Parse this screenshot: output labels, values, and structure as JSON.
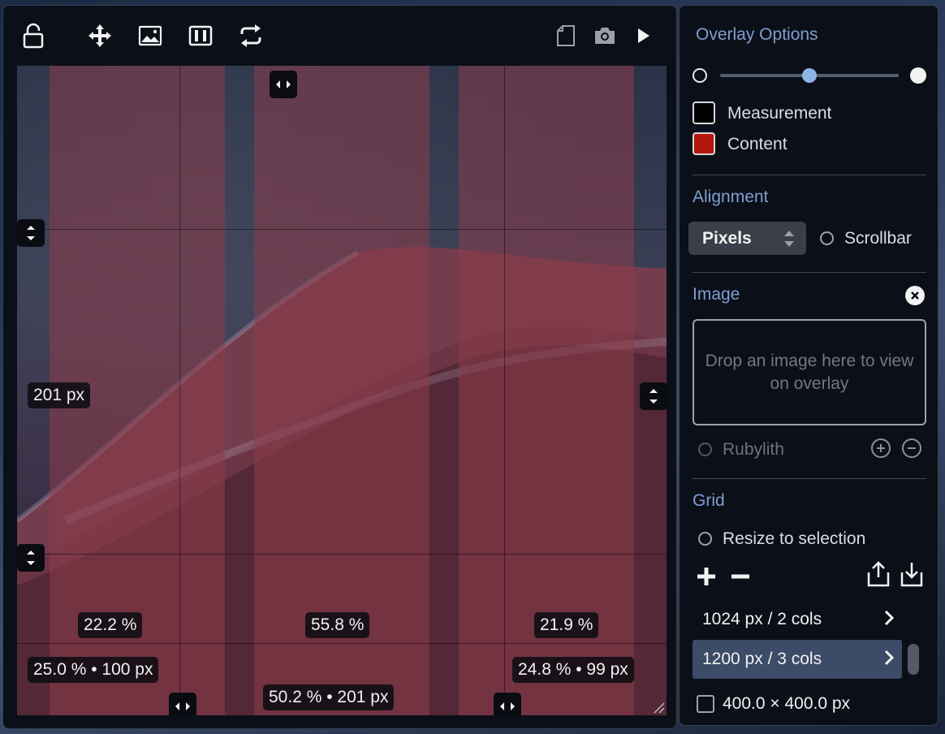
{
  "toolbar": {
    "icons": [
      "lock-icon",
      "move-icon",
      "image-icon",
      "columns-icon",
      "swap-icon",
      "document-icon",
      "camera-icon",
      "play-icon"
    ]
  },
  "overlay": {
    "labels": {
      "row_height": "201 px",
      "col1_pct": "22.2 %",
      "col2_pct": "55.8 %",
      "col3_pct": "21.9 %",
      "left_margin": "25.0 % • 100 px",
      "gutter_center": "50.2 % • 201 px",
      "right_margin": "24.8 % • 99 px"
    }
  },
  "panel": {
    "title": "Overlay Options",
    "opacity_level": 0.5,
    "colors": [
      {
        "label": "Measurement",
        "color": "#000000"
      },
      {
        "label": "Content",
        "color": "#b3170e"
      }
    ],
    "alignment": {
      "title": "Alignment",
      "mode": "Pixels",
      "scrollbar_label": "Scrollbar"
    },
    "image": {
      "title": "Image",
      "drop_text": "Drop an image here to view on overlay",
      "rubylith_label": "Rubylith"
    },
    "grid": {
      "title": "Grid",
      "resize_label": "Resize to selection",
      "items": [
        {
          "label": "1024 px / 2 cols",
          "selected": false
        },
        {
          "label": "1200 px / 3 cols",
          "selected": true
        }
      ],
      "size_label": "400.0 × 400.0 px"
    }
  },
  "theme": {
    "accent": "#7f9ed0",
    "content_color": "#b3170e",
    "panel_bg": "#0b0f18"
  }
}
